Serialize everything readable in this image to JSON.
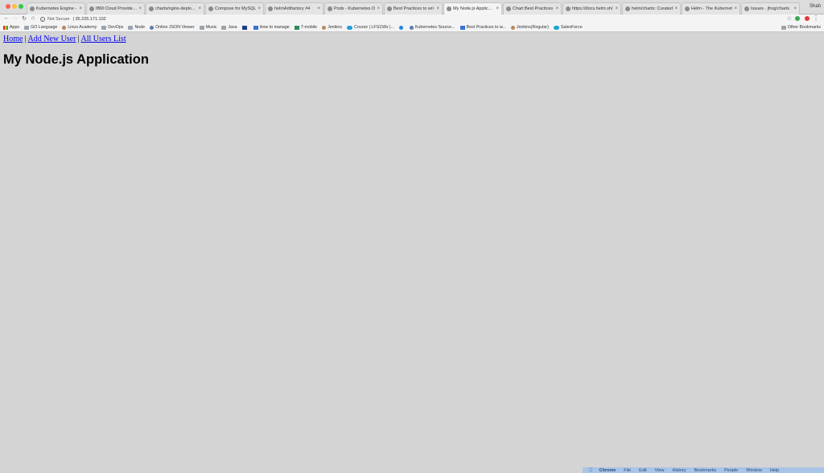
{
  "browser": {
    "profile_name": "Shah",
    "tabs": [
      {
        "title": "Kubernetes Engine - ",
        "active": false
      },
      {
        "title": "IBM Cloud Provider N",
        "active": false
      },
      {
        "title": "charts/nginx-deploym",
        "active": false
      },
      {
        "title": "Compose for MySQL",
        "active": false
      },
      {
        "title": "helmArtifactory #4",
        "active": false
      },
      {
        "title": "Pods - Kubernetes D",
        "active": false
      },
      {
        "title": "Best Practices to wri",
        "active": false
      },
      {
        "title": "My Node.js Applicatio",
        "active": true
      },
      {
        "title": "Chart Best Practices",
        "active": false
      },
      {
        "title": "https://docs.helm.sh/",
        "active": false
      },
      {
        "title": "helm/charts: Curated",
        "active": false
      },
      {
        "title": "Helm - The Kubernet",
        "active": false
      },
      {
        "title": "Issues · jfrog/charts",
        "active": false
      }
    ],
    "address": {
      "security_label": "Not Secure",
      "url": "35.225.171.102"
    },
    "bookmarks": [
      {
        "label": "Apps",
        "icon": "grid-icon"
      },
      {
        "label": "GO Language",
        "icon": "folder-icon"
      },
      {
        "label": "Linux Academy",
        "icon": "person-icon"
      },
      {
        "label": "DevOps",
        "icon": "folder-icon"
      },
      {
        "label": "Node",
        "icon": "folder-icon"
      },
      {
        "label": "Online JSON Viewer",
        "icon": "globe-icon"
      },
      {
        "label": "Music",
        "icon": "folder-icon"
      },
      {
        "label": "Java",
        "icon": "folder-icon"
      },
      {
        "label": "",
        "icon": "shield-icon"
      },
      {
        "label": "How to manage",
        "icon": "doc-icon"
      },
      {
        "label": "T-mobile",
        "icon": "green-icon"
      },
      {
        "label": "Jenkins",
        "icon": "person-icon"
      },
      {
        "label": "Course | LFS158x |...",
        "icon": "cloud-icon"
      },
      {
        "label": "",
        "icon": "circle-icon"
      },
      {
        "label": "Kubernetes Source...",
        "icon": "globe-icon"
      },
      {
        "label": "Best Practices to w...",
        "icon": "doc-icon"
      },
      {
        "label": "Jenkins(Regular)",
        "icon": "person-icon"
      },
      {
        "label": "SalesForce",
        "icon": "cloud-icon"
      }
    ],
    "other_bookmarks": "Other Bookmarks"
  },
  "page": {
    "nav": {
      "home": "Home",
      "add_user": "Add New User",
      "all_users": "All Users List",
      "separator": "|"
    },
    "title": "My Node.js Application"
  },
  "macos_menubar": {
    "items": [
      "Chrome",
      "File",
      "Edit",
      "View",
      "History",
      "Bookmarks",
      "People",
      "Window",
      "Help"
    ]
  }
}
